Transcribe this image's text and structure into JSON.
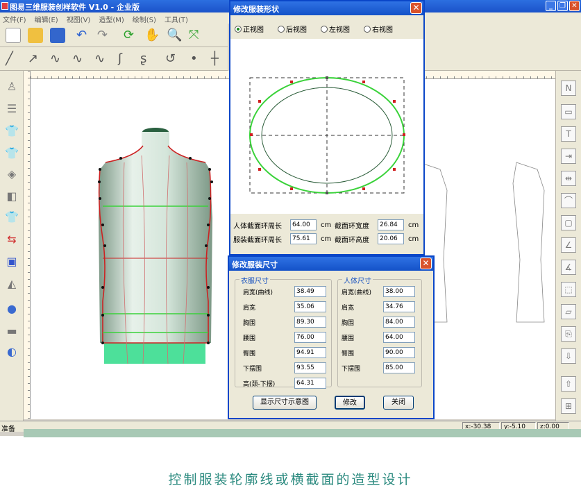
{
  "window": {
    "title": "图易三维服装创样软件 V1.0 - 企业版",
    "menu": [
      "文件(F)",
      "编辑(E)",
      "视图(V)",
      "造型(M)",
      "绘制(S)",
      "工具(T)"
    ]
  },
  "status": {
    "ready": "准备",
    "x": "x:-30.38",
    "y": "y:-5.10",
    "z": "z:0.00"
  },
  "shape_dialog": {
    "title": "修改服装形状",
    "views": [
      {
        "label": "正视图",
        "selected": true
      },
      {
        "label": "后视图",
        "selected": false
      },
      {
        "label": "左视图",
        "selected": false
      },
      {
        "label": "右视图",
        "selected": false
      }
    ],
    "body_perimeter_label": "人体截面环周长",
    "body_perimeter_value": "64.00",
    "garment_perimeter_label": "服装截面环周长",
    "garment_perimeter_value": "75.61",
    "width_label": "截面环宽度",
    "width_value": "26.84",
    "height_label": "截面环高度",
    "height_value": "20.06",
    "unit": "cm"
  },
  "size_dialog": {
    "title": "修改服装尺寸",
    "garment_group": "衣服尺寸",
    "body_group": "人体尺寸",
    "garment_rows": [
      {
        "label": "肩宽(曲线)",
        "value": "38.49"
      },
      {
        "label": "肩宽",
        "value": "35.06"
      },
      {
        "label": "胸围",
        "value": "89.30"
      },
      {
        "label": "腰围",
        "value": "76.00"
      },
      {
        "label": "臀围",
        "value": "94.91"
      },
      {
        "label": "下摆围",
        "value": "93.55"
      },
      {
        "label": "高(颈-下摆)",
        "value": "64.31"
      }
    ],
    "body_rows": [
      {
        "label": "肩宽(曲线)",
        "value": "38.00"
      },
      {
        "label": "肩宽",
        "value": "34.76"
      },
      {
        "label": "胸围",
        "value": "84.00"
      },
      {
        "label": "腰围",
        "value": "64.00"
      },
      {
        "label": "臀围",
        "value": "90.00"
      },
      {
        "label": "下摆围",
        "value": "85.00"
      }
    ],
    "show_button": "显示尺寸示意图",
    "modify_button": "修改",
    "close_button": "关闭"
  },
  "caption": "控制服装轮廓线或横截面的造型设计",
  "colors": {
    "titlebar": "#1b52c9",
    "outline": "#e03a3a",
    "body_green": "#3ad23a",
    "mannequin": "#cfe3d6"
  }
}
